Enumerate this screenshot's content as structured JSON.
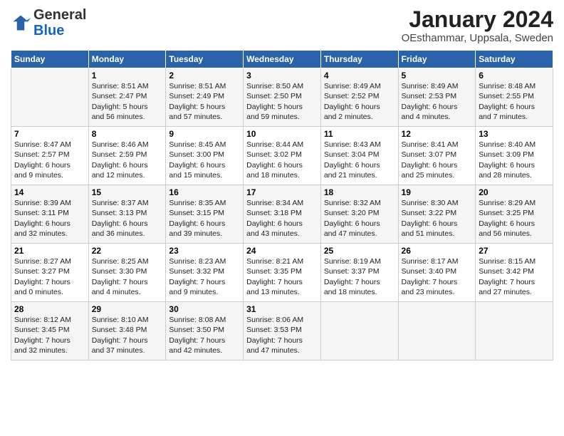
{
  "header": {
    "logo_general": "General",
    "logo_blue": "Blue",
    "title": "January 2024",
    "subtitle": "OEsthammar, Uppsala, Sweden"
  },
  "days_of_week": [
    "Sunday",
    "Monday",
    "Tuesday",
    "Wednesday",
    "Thursday",
    "Friday",
    "Saturday"
  ],
  "weeks": [
    [
      {
        "day": "",
        "info": ""
      },
      {
        "day": "1",
        "info": "Sunrise: 8:51 AM\nSunset: 2:47 PM\nDaylight: 5 hours\nand 56 minutes."
      },
      {
        "day": "2",
        "info": "Sunrise: 8:51 AM\nSunset: 2:49 PM\nDaylight: 5 hours\nand 57 minutes."
      },
      {
        "day": "3",
        "info": "Sunrise: 8:50 AM\nSunset: 2:50 PM\nDaylight: 5 hours\nand 59 minutes."
      },
      {
        "day": "4",
        "info": "Sunrise: 8:49 AM\nSunset: 2:52 PM\nDaylight: 6 hours\nand 2 minutes."
      },
      {
        "day": "5",
        "info": "Sunrise: 8:49 AM\nSunset: 2:53 PM\nDaylight: 6 hours\nand 4 minutes."
      },
      {
        "day": "6",
        "info": "Sunrise: 8:48 AM\nSunset: 2:55 PM\nDaylight: 6 hours\nand 7 minutes."
      }
    ],
    [
      {
        "day": "7",
        "info": "Sunrise: 8:47 AM\nSunset: 2:57 PM\nDaylight: 6 hours\nand 9 minutes."
      },
      {
        "day": "8",
        "info": "Sunrise: 8:46 AM\nSunset: 2:59 PM\nDaylight: 6 hours\nand 12 minutes."
      },
      {
        "day": "9",
        "info": "Sunrise: 8:45 AM\nSunset: 3:00 PM\nDaylight: 6 hours\nand 15 minutes."
      },
      {
        "day": "10",
        "info": "Sunrise: 8:44 AM\nSunset: 3:02 PM\nDaylight: 6 hours\nand 18 minutes."
      },
      {
        "day": "11",
        "info": "Sunrise: 8:43 AM\nSunset: 3:04 PM\nDaylight: 6 hours\nand 21 minutes."
      },
      {
        "day": "12",
        "info": "Sunrise: 8:41 AM\nSunset: 3:07 PM\nDaylight: 6 hours\nand 25 minutes."
      },
      {
        "day": "13",
        "info": "Sunrise: 8:40 AM\nSunset: 3:09 PM\nDaylight: 6 hours\nand 28 minutes."
      }
    ],
    [
      {
        "day": "14",
        "info": "Sunrise: 8:39 AM\nSunset: 3:11 PM\nDaylight: 6 hours\nand 32 minutes."
      },
      {
        "day": "15",
        "info": "Sunrise: 8:37 AM\nSunset: 3:13 PM\nDaylight: 6 hours\nand 36 minutes."
      },
      {
        "day": "16",
        "info": "Sunrise: 8:35 AM\nSunset: 3:15 PM\nDaylight: 6 hours\nand 39 minutes."
      },
      {
        "day": "17",
        "info": "Sunrise: 8:34 AM\nSunset: 3:18 PM\nDaylight: 6 hours\nand 43 minutes."
      },
      {
        "day": "18",
        "info": "Sunrise: 8:32 AM\nSunset: 3:20 PM\nDaylight: 6 hours\nand 47 minutes."
      },
      {
        "day": "19",
        "info": "Sunrise: 8:30 AM\nSunset: 3:22 PM\nDaylight: 6 hours\nand 51 minutes."
      },
      {
        "day": "20",
        "info": "Sunrise: 8:29 AM\nSunset: 3:25 PM\nDaylight: 6 hours\nand 56 minutes."
      }
    ],
    [
      {
        "day": "21",
        "info": "Sunrise: 8:27 AM\nSunset: 3:27 PM\nDaylight: 7 hours\nand 0 minutes."
      },
      {
        "day": "22",
        "info": "Sunrise: 8:25 AM\nSunset: 3:30 PM\nDaylight: 7 hours\nand 4 minutes."
      },
      {
        "day": "23",
        "info": "Sunrise: 8:23 AM\nSunset: 3:32 PM\nDaylight: 7 hours\nand 9 minutes."
      },
      {
        "day": "24",
        "info": "Sunrise: 8:21 AM\nSunset: 3:35 PM\nDaylight: 7 hours\nand 13 minutes."
      },
      {
        "day": "25",
        "info": "Sunrise: 8:19 AM\nSunset: 3:37 PM\nDaylight: 7 hours\nand 18 minutes."
      },
      {
        "day": "26",
        "info": "Sunrise: 8:17 AM\nSunset: 3:40 PM\nDaylight: 7 hours\nand 23 minutes."
      },
      {
        "day": "27",
        "info": "Sunrise: 8:15 AM\nSunset: 3:42 PM\nDaylight: 7 hours\nand 27 minutes."
      }
    ],
    [
      {
        "day": "28",
        "info": "Sunrise: 8:12 AM\nSunset: 3:45 PM\nDaylight: 7 hours\nand 32 minutes."
      },
      {
        "day": "29",
        "info": "Sunrise: 8:10 AM\nSunset: 3:48 PM\nDaylight: 7 hours\nand 37 minutes."
      },
      {
        "day": "30",
        "info": "Sunrise: 8:08 AM\nSunset: 3:50 PM\nDaylight: 7 hours\nand 42 minutes."
      },
      {
        "day": "31",
        "info": "Sunrise: 8:06 AM\nSunset: 3:53 PM\nDaylight: 7 hours\nand 47 minutes."
      },
      {
        "day": "",
        "info": ""
      },
      {
        "day": "",
        "info": ""
      },
      {
        "day": "",
        "info": ""
      }
    ]
  ]
}
